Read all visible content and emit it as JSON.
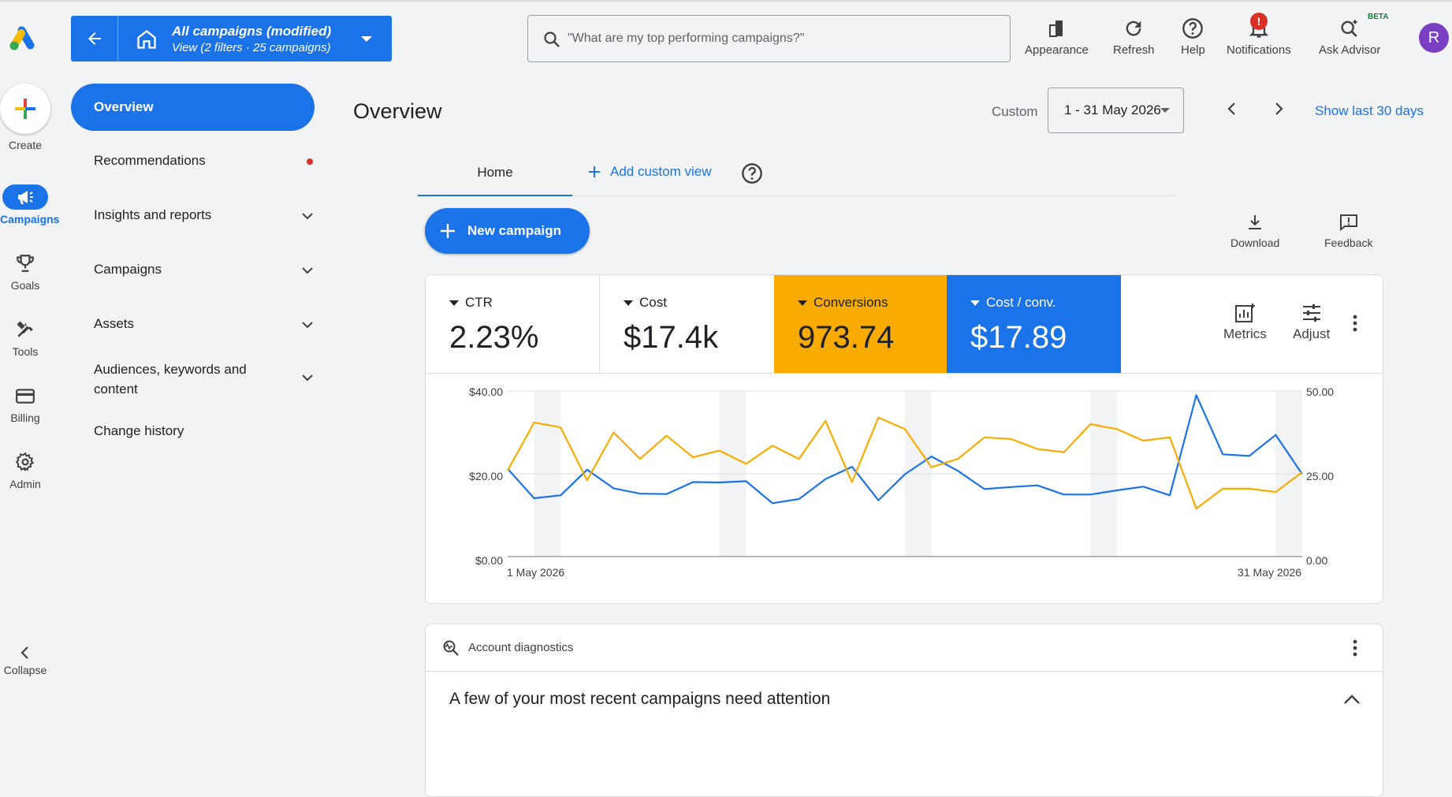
{
  "topbar": {
    "account_title": "All campaigns (modified)",
    "account_subtitle": "View (2 filters · 25 campaigns)",
    "search_placeholder": "\"What are my top performing campaigns?\"",
    "buttons": [
      {
        "label": "Appearance",
        "icon": "appearance-icon"
      },
      {
        "label": "Refresh",
        "icon": "refresh-icon"
      },
      {
        "label": "Help",
        "icon": "help-icon"
      },
      {
        "label": "Notifications",
        "icon": "bell-icon",
        "badge": "!"
      },
      {
        "label": "Ask Advisor",
        "icon": "advisor-icon",
        "tag": "BETA"
      }
    ],
    "avatar_initial": "R"
  },
  "rail": {
    "create_label": "Create",
    "items": [
      {
        "label": "Campaigns",
        "icon": "megaphone-icon",
        "active": true
      },
      {
        "label": "Goals",
        "icon": "trophy-icon"
      },
      {
        "label": "Tools",
        "icon": "tools-icon"
      },
      {
        "label": "Billing",
        "icon": "billing-icon"
      },
      {
        "label": "Admin",
        "icon": "gear-icon"
      }
    ],
    "collapse_label": "Collapse"
  },
  "nav": {
    "overview": "Overview",
    "items": [
      {
        "label": "Recommendations",
        "dot": true
      },
      {
        "label": "Insights and reports",
        "expandable": true
      },
      {
        "label": "Campaigns",
        "expandable": true
      },
      {
        "label": "Assets",
        "expandable": true
      },
      {
        "label": "Audiences, keywords and content",
        "expandable": true
      },
      {
        "label": "Change history"
      }
    ]
  },
  "main": {
    "title": "Overview",
    "custom_label": "Custom",
    "date_range": "1 - 31 May 2026",
    "show_last": "Show last 30 days",
    "tabs": {
      "home": "Home",
      "add_custom_view": "Add custom view"
    },
    "new_campaign": "New campaign",
    "download": "Download",
    "feedback": "Feedback"
  },
  "metrics": [
    {
      "label": "CTR",
      "value": "2.23%"
    },
    {
      "label": "Cost",
      "value": "$17.4k"
    },
    {
      "label": "Conversions",
      "value": "973.74",
      "color": "#f9ab00"
    },
    {
      "label": "Cost / conv.",
      "value": "$17.89",
      "color": "#1a73e8"
    }
  ],
  "metric_actions": {
    "metrics": "Metrics",
    "adjust": "Adjust"
  },
  "chart_data": {
    "type": "line",
    "x_labels": [
      "1 May 2026",
      "31 May 2026"
    ],
    "y_left_ticks": [
      "$40.00",
      "$20.00",
      "$0.00"
    ],
    "y_right_ticks": [
      "50.00",
      "25.00",
      "0.00"
    ],
    "ylim_left": [
      0,
      40
    ],
    "ylim_right": [
      0,
      50
    ],
    "weekend_bands_start_day": [
      2,
      9,
      16,
      23,
      30
    ],
    "series": [
      {
        "name": "Cost / conv.",
        "axis": "left",
        "color": "#1a73e8",
        "values": [
          21.2,
          14.1,
          14.8,
          21.0,
          16.5,
          15.2,
          15.1,
          18.0,
          17.9,
          18.2,
          12.9,
          13.9,
          18.7,
          21.7,
          13.6,
          19.9,
          24.2,
          20.7,
          16.3,
          16.8,
          17.2,
          15.0,
          15.0,
          16.0,
          16.9,
          14.8,
          39.0,
          24.7,
          24.3,
          29.4,
          19.9
        ]
      },
      {
        "name": "Conversions",
        "axis": "right",
        "color": "#f9ab00",
        "values": [
          26,
          40.5,
          39,
          23,
          37.5,
          29.5,
          36.5,
          30,
          32,
          28,
          33.5,
          29.5,
          41,
          22.5,
          42,
          38.5,
          27,
          29.5,
          36,
          35.5,
          32.5,
          31.5,
          40,
          38.5,
          35,
          36,
          14.5,
          20.5,
          20.5,
          19.5,
          25.5
        ]
      }
    ]
  },
  "diagnostics": {
    "title": "Account diagnostics",
    "message": "A few of your most recent campaigns need attention"
  }
}
